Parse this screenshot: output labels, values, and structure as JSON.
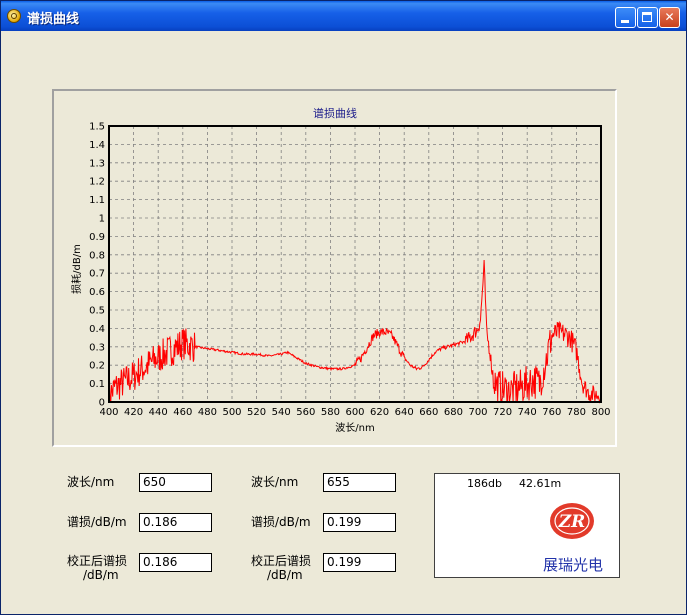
{
  "window": {
    "title": "谱损曲线"
  },
  "chart_data": {
    "type": "line",
    "title": "谱损曲线",
    "xlabel": "波长/nm",
    "ylabel": "损耗/dB/m",
    "xlim": [
      400,
      800
    ],
    "ylim": [
      0,
      1.5
    ],
    "x_ticks": [
      400,
      420,
      440,
      460,
      480,
      500,
      520,
      540,
      560,
      580,
      600,
      620,
      640,
      660,
      680,
      700,
      720,
      740,
      760,
      780,
      800
    ],
    "y_ticks": [
      0,
      0.1,
      0.2,
      0.3,
      0.4,
      0.5,
      0.6,
      0.7,
      0.8,
      0.9,
      1,
      1.1,
      1.2,
      1.3,
      1.4,
      1.5
    ],
    "grid": true,
    "series": [
      {
        "color": "#FF0000",
        "x": [
          400,
          405,
          410,
          415,
          420,
          425,
          430,
          435,
          440,
          445,
          450,
          455,
          460,
          465,
          470,
          480,
          490,
          500,
          510,
          520,
          530,
          540,
          545,
          550,
          560,
          570,
          580,
          590,
          600,
          605,
          610,
          615,
          620,
          625,
          630,
          635,
          640,
          645,
          650,
          655,
          660,
          665,
          670,
          680,
          690,
          695,
          700,
          702,
          705,
          707,
          710,
          712,
          715,
          720,
          725,
          730,
          735,
          740,
          745,
          750,
          755,
          760,
          765,
          770,
          775,
          780,
          785,
          790,
          795,
          800
        ],
        "y": [
          0.03,
          0.08,
          0.1,
          0.12,
          0.14,
          0.17,
          0.19,
          0.22,
          0.24,
          0.26,
          0.28,
          0.3,
          0.32,
          0.31,
          0.3,
          0.29,
          0.28,
          0.27,
          0.26,
          0.26,
          0.25,
          0.26,
          0.27,
          0.25,
          0.21,
          0.19,
          0.18,
          0.18,
          0.2,
          0.24,
          0.3,
          0.36,
          0.38,
          0.38,
          0.36,
          0.3,
          0.24,
          0.2,
          0.18,
          0.19,
          0.23,
          0.27,
          0.29,
          0.31,
          0.33,
          0.36,
          0.4,
          0.45,
          0.74,
          0.38,
          0.26,
          0.14,
          0.09,
          0.07,
          0.06,
          0.07,
          0.08,
          0.1,
          0.12,
          0.1,
          0.22,
          0.36,
          0.38,
          0.37,
          0.35,
          0.28,
          0.1,
          0.05,
          0.04,
          0.04
        ]
      }
    ]
  },
  "fields": {
    "left": {
      "wavelength_label": "波长/nm",
      "wavelength_value": "650",
      "loss_label": "谱损/dB/m",
      "loss_value": "0.186",
      "corrected_label_1": "校正后谱损",
      "corrected_label_2": "/dB/m",
      "corrected_value": "0.186"
    },
    "right": {
      "wavelength_label": "波长/nm",
      "wavelength_value": "655",
      "loss_label": "谱损/dB/m",
      "loss_value": "0.199",
      "corrected_label_1": "校正后谱损",
      "corrected_label_2": "/dB/m",
      "corrected_value": "0.199"
    }
  },
  "logo_box": {
    "db_value": "186db",
    "length_value": "42.61m",
    "mark_text": "ZR",
    "company": "展瑞光电",
    "brand_color": "#E23A2A",
    "company_color": "#2233AA"
  }
}
